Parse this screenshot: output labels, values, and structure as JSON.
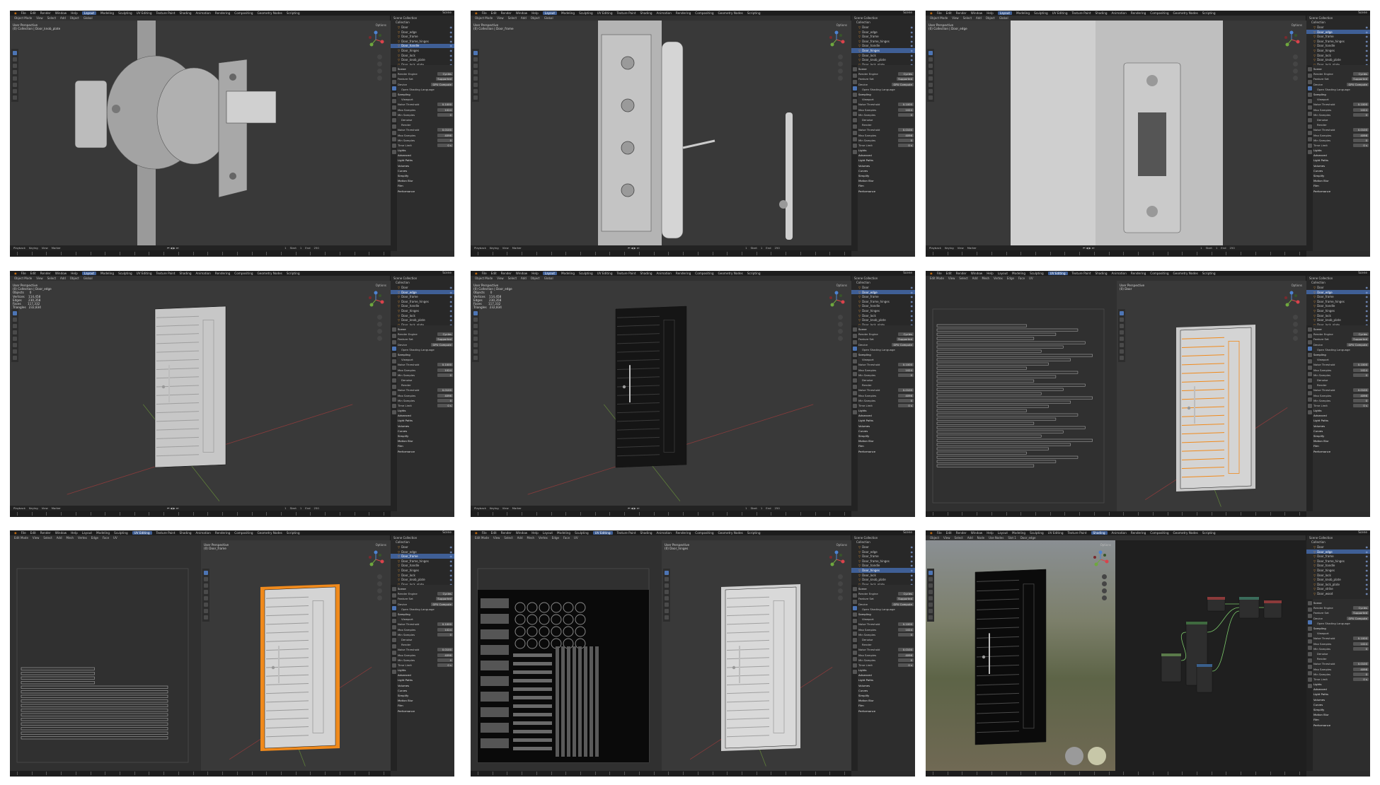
{
  "menus": [
    "File",
    "Edit",
    "Render",
    "Window",
    "Help"
  ],
  "workspaces": [
    "Layout",
    "Modeling",
    "Sculpting",
    "UV Editing",
    "Texture Paint",
    "Shading",
    "Animation",
    "Rendering",
    "Compositing",
    "Geometry Nodes",
    "Scripting"
  ],
  "scene": {
    "label": "Scene",
    "view_layer": "ViewLayer"
  },
  "viewport_header": {
    "mode": "Object Mode",
    "items": [
      "View",
      "Select",
      "Add",
      "Object"
    ],
    "transform": "Global",
    "options": "Options"
  },
  "edit_header": {
    "mode": "Edit Mode",
    "items": [
      "View",
      "Select",
      "Add",
      "Mesh",
      "Vertex",
      "Edge",
      "Face",
      "UV"
    ]
  },
  "uv_header": {
    "items": [
      "View",
      "Select",
      "Image",
      "UV"
    ]
  },
  "shading_header": {
    "items": [
      "Object",
      "View",
      "Select",
      "Add",
      "Node",
      "Use Nodes"
    ],
    "slot": "Slot 1",
    "material": "Door_edge"
  },
  "outliner": {
    "collection_label": "Scene Collection",
    "collection": "Collection",
    "items": [
      "Door",
      "Door_edge",
      "Door_frame",
      "Door_frame_hinges",
      "Door_handle",
      "Door_hinges",
      "Door_lock",
      "Door_knob_plate",
      "Door_lock_plate",
      "Door_strike",
      "Door_wood"
    ]
  },
  "properties": {
    "scene": "Scene",
    "render_engine_label": "Render Engine",
    "render_engine": "Cycles",
    "feature_set_label": "Feature Set",
    "feature_set": "Supported",
    "device_label": "Device",
    "device": "GPU Compute",
    "osl_label": "Open Shading Language",
    "sampling": "Sampling",
    "viewport": "Viewport",
    "noise_threshold_label": "Noise Threshold",
    "noise_threshold": "0.1000",
    "max_samples_label": "Max Samples",
    "max_samples_viewport": "1024",
    "min_samples_label": "Min Samples",
    "min_samples": "0",
    "denoise": "Denoise",
    "render": "Render",
    "render_noise_threshold": "0.0100",
    "render_max_samples": "4096",
    "time_limit_label": "Time Limit",
    "time_limit": "0 s",
    "sections": [
      "Lights",
      "Advanced",
      "Light Paths",
      "Volumes",
      "Curves",
      "Simplify",
      "Motion Blur",
      "Film",
      "Performance"
    ]
  },
  "timeline": {
    "items": [
      "Playback",
      "Keying",
      "View",
      "Marker"
    ],
    "start_label": "Start",
    "start": "1",
    "end_label": "End",
    "end": "250",
    "frame": "1",
    "ruler": [
      "0",
      "10",
      "20",
      "30",
      "40",
      "50",
      "60",
      "70",
      "80",
      "90",
      "100",
      "110",
      "120",
      "130",
      "140",
      "150",
      "160",
      "170",
      "180",
      "190",
      "200",
      "210",
      "220",
      "230",
      "240",
      "250"
    ]
  },
  "panels": [
    {
      "info": "User Perspective\n(0) Collection | Door_knob_plate"
    },
    {
      "info": "User Perspective\n(0) Collection | Door_frame"
    },
    {
      "info": "User Perspective\n(0) Collection | Door_edge"
    },
    {
      "info": "User Perspective\n(0) Collection | Door_edge\nObjects      0\nVertices    114,458\nEdges       230,358\nFaces       117,332\nTriangles   232,834"
    },
    {
      "info": "User Perspective\n(0) Collection | Door_edge\nObjects      0\nVertices    114,458\nEdges       230,358\nFaces       117,332\nTriangles   232,834"
    },
    {
      "info": "User Perspective\n(0) Door"
    },
    {
      "info": "User Perspective\n(0) Door_frame"
    },
    {
      "info": "User Perspective\n(0) Door_hinges"
    },
    {
      "info": ""
    }
  ],
  "colors": {
    "ui_bg": "#2b2b2b",
    "viewport": "#393939",
    "accent": "#3f5f96",
    "orange_select": "#f08a1c"
  }
}
